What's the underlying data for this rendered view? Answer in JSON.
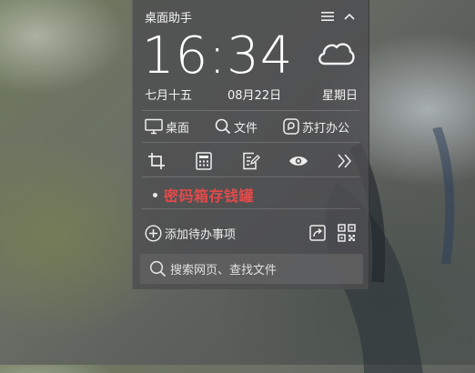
{
  "widget": {
    "title": "桌面助手",
    "time": "16:34",
    "lunar_date": "七月十五",
    "date": "08月22日",
    "weekday": "星期日",
    "weather_icon": "cloud-icon"
  },
  "quick_links": [
    {
      "label": "桌面",
      "icon": "monitor-icon"
    },
    {
      "label": "文件",
      "icon": "search-icon"
    },
    {
      "label": "苏打办公",
      "icon": "soda-office-icon"
    }
  ],
  "tools": [
    "crop-icon",
    "calculator-icon",
    "note-edit-icon",
    "eye-icon",
    "double-chevron-right-icon"
  ],
  "note": {
    "text": "密码箱存钱罐",
    "color": "#e34a4a"
  },
  "todo": {
    "add_label": "添加待办事项"
  },
  "search": {
    "placeholder": "搜索网页、查找文件"
  }
}
